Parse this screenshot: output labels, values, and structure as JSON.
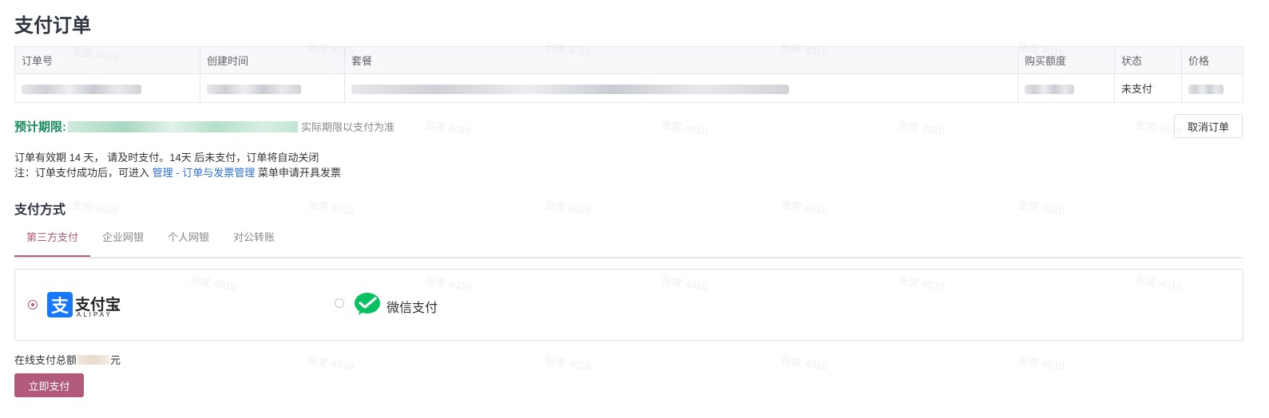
{
  "page": {
    "title": "支付订单"
  },
  "order_table": {
    "columns": [
      "订单号",
      "创建时间",
      "套餐",
      "购买额度",
      "状态",
      "价格"
    ],
    "rows": [
      {
        "status": "未支付"
      }
    ]
  },
  "estimate": {
    "label": "预计期限:",
    "note": "实际期限以支付为准"
  },
  "cancel_button": "取消订单",
  "notice": {
    "line1": "订单有效期 14 天， 请及时支付。14天 后未支付，订单将自动关闭",
    "line2_prefix": "注：订单支付成功后，可进入 ",
    "link1": "管理",
    "separator": " - ",
    "link2": "订单与发票管理",
    "line2_suffix": " 菜单申请开具发票"
  },
  "payment_section": {
    "title": "支付方式",
    "tabs": [
      "第三方支付",
      "企业网银",
      "个人网银",
      "对公转账"
    ],
    "active_tab": "第三方支付",
    "methods": [
      {
        "name": "支付宝",
        "sub": "ALIPAY",
        "selected": true,
        "icon": "alipay-icon"
      },
      {
        "name": "微信支付",
        "selected": false,
        "icon": "wechat-icon"
      }
    ]
  },
  "total": {
    "prefix": "在线支付总额",
    "suffix": "元"
  },
  "pay_button": "立即支付",
  "watermark": {
    "text": "张雯 4010"
  },
  "colors": {
    "accent": "#b25a7b",
    "estimate_label": "#1a8a5c",
    "link": "#2d6fd6",
    "alipay_blue": "#1677ff",
    "wechat_green": "#07c160"
  }
}
